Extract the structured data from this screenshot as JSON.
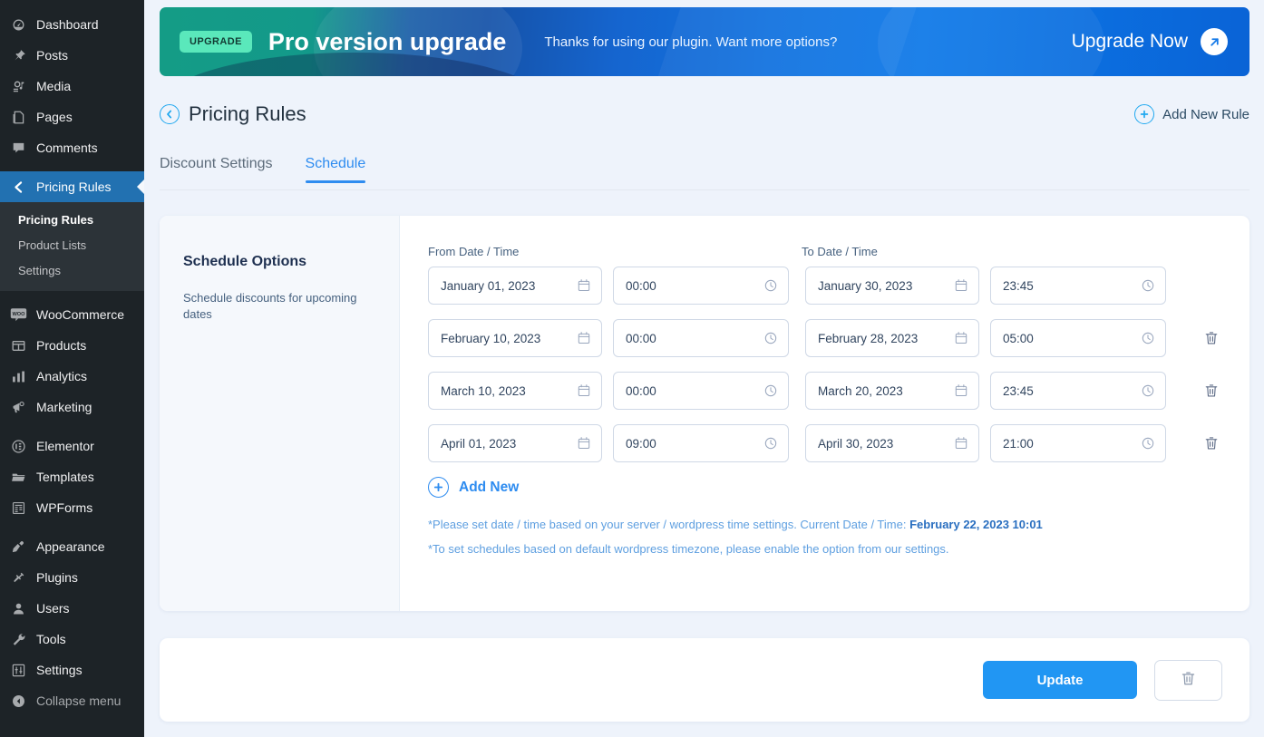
{
  "sidebar": {
    "items": [
      {
        "label": "Dashboard",
        "icon": "dashboard-icon",
        "key": "dashboard"
      },
      {
        "label": "Posts",
        "icon": "pin-icon",
        "key": "posts"
      },
      {
        "label": "Media",
        "icon": "media-icon",
        "key": "media"
      },
      {
        "label": "Pages",
        "icon": "pages-icon",
        "key": "pages"
      },
      {
        "label": "Comments",
        "icon": "comments-icon",
        "key": "comments"
      },
      {
        "label": "Pricing Rules",
        "icon": "chevron-left-icon",
        "key": "pricing-rules",
        "current": true
      },
      {
        "label": "WooCommerce",
        "icon": "woo-icon",
        "key": "woocommerce"
      },
      {
        "label": "Products",
        "icon": "products-icon",
        "key": "products"
      },
      {
        "label": "Analytics",
        "icon": "analytics-icon",
        "key": "analytics"
      },
      {
        "label": "Marketing",
        "icon": "megaphone-icon",
        "key": "marketing"
      },
      {
        "label": "Elementor",
        "icon": "elementor-icon",
        "key": "elementor"
      },
      {
        "label": "Templates",
        "icon": "folder-icon",
        "key": "templates"
      },
      {
        "label": "WPForms",
        "icon": "wpforms-icon",
        "key": "wpforms"
      },
      {
        "label": "Appearance",
        "icon": "brush-icon",
        "key": "appearance"
      },
      {
        "label": "Plugins",
        "icon": "plug-icon",
        "key": "plugins"
      },
      {
        "label": "Users",
        "icon": "user-icon",
        "key": "users"
      },
      {
        "label": "Tools",
        "icon": "wrench-icon",
        "key": "tools"
      },
      {
        "label": "Settings",
        "icon": "sliders-icon",
        "key": "settings"
      }
    ],
    "submenu": [
      {
        "label": "Pricing Rules",
        "active": true
      },
      {
        "label": "Product Lists",
        "active": false
      },
      {
        "label": "Settings",
        "active": false
      }
    ],
    "collapse": {
      "label": "Collapse menu",
      "icon": "collapse-icon"
    }
  },
  "promo": {
    "badge": "UPGRADE",
    "title": "Pro version upgrade",
    "subtitle": "Thanks for using our plugin. Want more options?",
    "cta": "Upgrade Now",
    "cta_icon": "arrow-up-right-icon",
    "accent_start": "#149c86",
    "accent_end": "#0a63d6"
  },
  "header": {
    "back_icon": "chevron-left-circle-icon",
    "title": "Pricing Rules",
    "add_rule_label": "Add New Rule",
    "add_rule_icon": "plus-circle-icon"
  },
  "tabs": [
    {
      "label": "Discount Settings",
      "active": false
    },
    {
      "label": "Schedule",
      "active": true
    }
  ],
  "options_pane": {
    "title": "Schedule Options",
    "description": "Schedule discounts for upcoming dates"
  },
  "schedule": {
    "col_from": "From Date / Time",
    "col_to": "To Date / Time",
    "date_icon": "calendar-icon",
    "time_icon": "clock-icon",
    "delete_icon": "trash-icon",
    "rows": [
      {
        "from_date": "January 01, 2023",
        "from_time": "00:00",
        "to_date": "January 30, 2023",
        "to_time": "23:45",
        "deletable": false
      },
      {
        "from_date": "February 10, 2023",
        "from_time": "00:00",
        "to_date": "February 28, 2023",
        "to_time": "05:00",
        "deletable": true
      },
      {
        "from_date": "March 10, 2023",
        "from_time": "00:00",
        "to_date": "March 20, 2023",
        "to_time": "23:45",
        "deletable": true
      },
      {
        "from_date": "April 01, 2023",
        "from_time": "09:00",
        "to_date": "April 30, 2023",
        "to_time": "21:00",
        "deletable": true
      }
    ],
    "add_new_label": "Add New",
    "add_new_icon": "plus-circle-icon",
    "note_1_prefix": "*Please set date / time based on your server / wordpress time settings. Current Date / Time: ",
    "note_1_value": "February 22, 2023 10:01",
    "note_2": "*To set schedules based on default wordpress timezone, please enable the option from our settings."
  },
  "footer": {
    "update_label": "Update",
    "delete_icon": "trash-icon",
    "update_color": "#2196f3"
  }
}
